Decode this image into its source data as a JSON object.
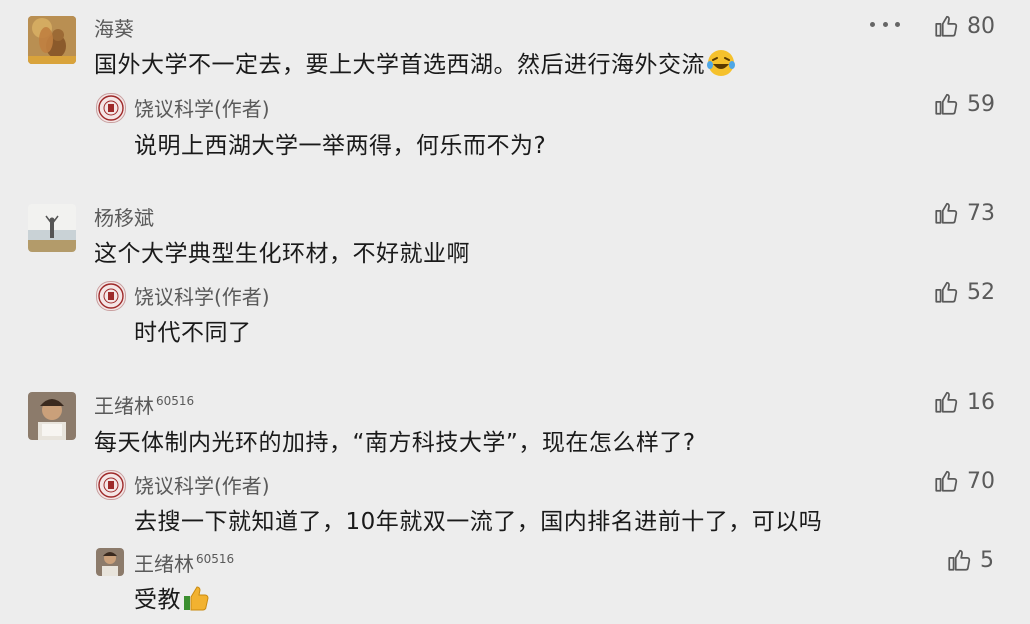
{
  "comments": [
    {
      "name": "海葵",
      "text": "国外大学不一定去，要上大学首选西湖。然后进行海外交流",
      "text_suffix_icon": "laughing-tears-emoji",
      "likes": "80",
      "replies": [
        {
          "name": "饶议科学(作者)",
          "text": "说明上西湖大学一举两得，何乐而不为?",
          "likes": "59"
        }
      ]
    },
    {
      "name": "杨移斌",
      "text": "这个大学典型生化环材，不好就业啊",
      "likes": "73",
      "replies": [
        {
          "name": "饶议科学(作者)",
          "text": "时代不同了",
          "likes": "52"
        }
      ]
    },
    {
      "name": "王绪林",
      "name_badge": "60516",
      "text": "每天体制内光环的加持，“南方科技大学”，现在怎么样了?",
      "likes": "16",
      "replies": [
        {
          "name": "饶议科学(作者)",
          "text": "去搜一下就知道了，10年就双一流了，国内排名进前十了，可以吗",
          "likes": "70"
        },
        {
          "name": "王绪林",
          "name_badge": "60516",
          "text": "受教",
          "text_suffix_icon": "thumbs-up-emoji",
          "likes": "5"
        }
      ]
    }
  ],
  "icons": {
    "like": "thumbs-up-icon",
    "more": "more-icon"
  },
  "colors": {
    "background": "#ededed",
    "text": "#1a1a1a",
    "meta": "#5a5a5a"
  }
}
